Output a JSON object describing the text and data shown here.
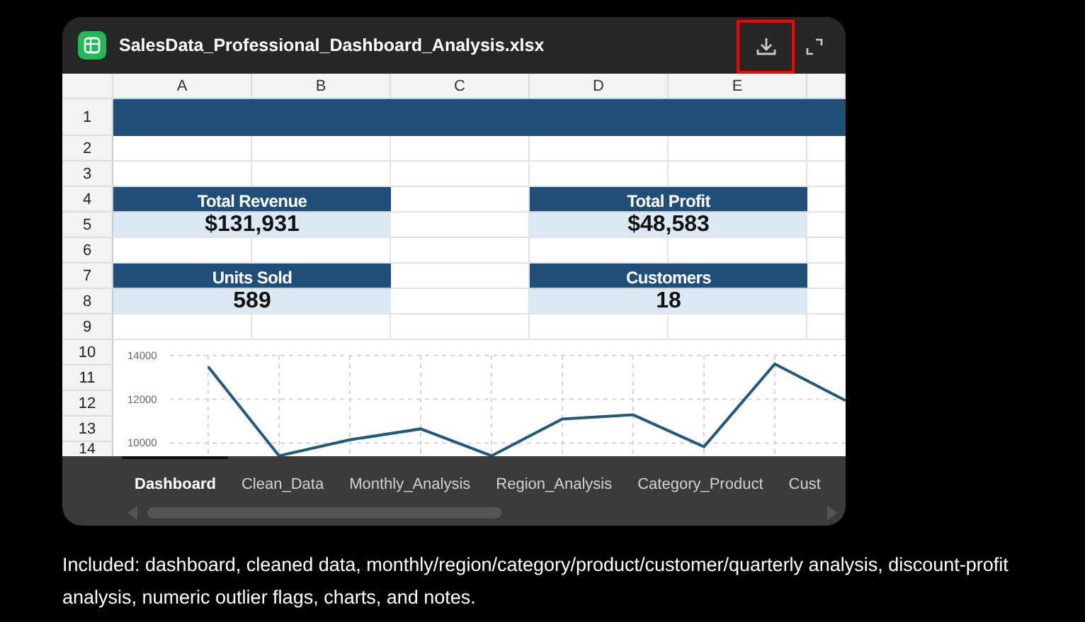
{
  "file": {
    "name": "SalesData_Professional_Dashboard_Analysis.xlsx"
  },
  "toolbar": [
    {
      "kind": "download",
      "highlighted": true
    },
    {
      "kind": "expand",
      "highlighted": false
    }
  ],
  "sheet": {
    "columns": [
      "A",
      "B",
      "C",
      "D",
      "E"
    ],
    "rows": [
      "1",
      "2",
      "3",
      "4",
      "5",
      "6",
      "7",
      "8",
      "9",
      "10",
      "11",
      "12",
      "13",
      "14"
    ],
    "kpis": [
      {
        "label": "Total Revenue",
        "value": "$131,931"
      },
      {
        "label": "Total Profit",
        "value": "$48,583"
      },
      {
        "label": "Units Sold",
        "value": "589"
      },
      {
        "label": "Customers",
        "value": "18"
      }
    ],
    "chart_data": {
      "type": "line",
      "grid": true,
      "ylim": [
        9400,
        14700
      ],
      "yticks": [
        10000,
        12000,
        14000
      ],
      "series": [
        {
          "color": "#1f5a7a",
          "values": [
            13480,
            9420,
            10150,
            10650,
            9420,
            11100,
            11290,
            9830,
            13610,
            11940
          ]
        }
      ]
    }
  },
  "tabs": [
    {
      "label": "Dashboard",
      "selected": true
    },
    {
      "label": "Clean_Data",
      "selected": false
    },
    {
      "label": "Monthly_Analysis",
      "selected": false
    },
    {
      "label": "Region_Analysis",
      "selected": false
    },
    {
      "label": "Category_Product",
      "selected": false
    },
    {
      "label": "Cust",
      "selected": false
    }
  ],
  "caption": "Included: dashboard, cleaned data, monthly/region/category/product/customer/quarterly analysis, discount-profit analysis, numeric outlier flags, charts, and notes."
}
